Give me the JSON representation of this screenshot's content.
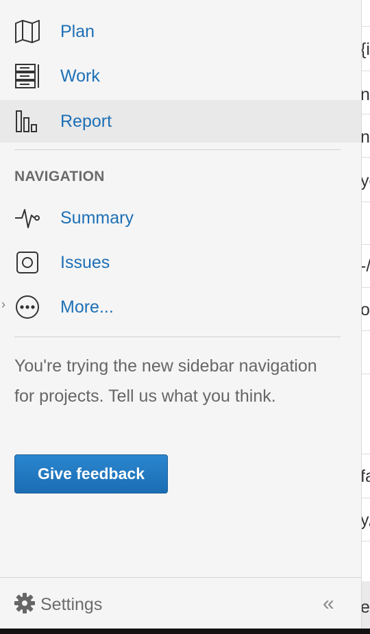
{
  "sidebar": {
    "top_items": [
      {
        "label": "Plan",
        "icon": "map-icon"
      },
      {
        "label": "Work",
        "icon": "board-icon"
      },
      {
        "label": "Report",
        "icon": "bar-chart-icon",
        "active": true
      }
    ],
    "section_title": "NAVIGATION",
    "nav_items": [
      {
        "label": "Summary",
        "icon": "pulse-icon"
      },
      {
        "label": "Issues",
        "icon": "issues-icon"
      },
      {
        "label": "More...",
        "icon": "more-icon"
      }
    ],
    "promo_text": "You're trying the new sidebar navigation for projects. Tell us what you think.",
    "feedback_button": "Give feedback",
    "settings_label": "Settings",
    "collapse_glyph": "«"
  },
  "right_panel_fragments": [
    "{i",
    "nc",
    "ne",
    "yc",
    "-/i",
    "op",
    "fa",
    "y/",
    "e"
  ],
  "colors": {
    "link": "#1d6fb5",
    "sidebar_bg": "#f5f5f5",
    "active_bg": "#e9e9e9",
    "button": "#1f74bb"
  }
}
